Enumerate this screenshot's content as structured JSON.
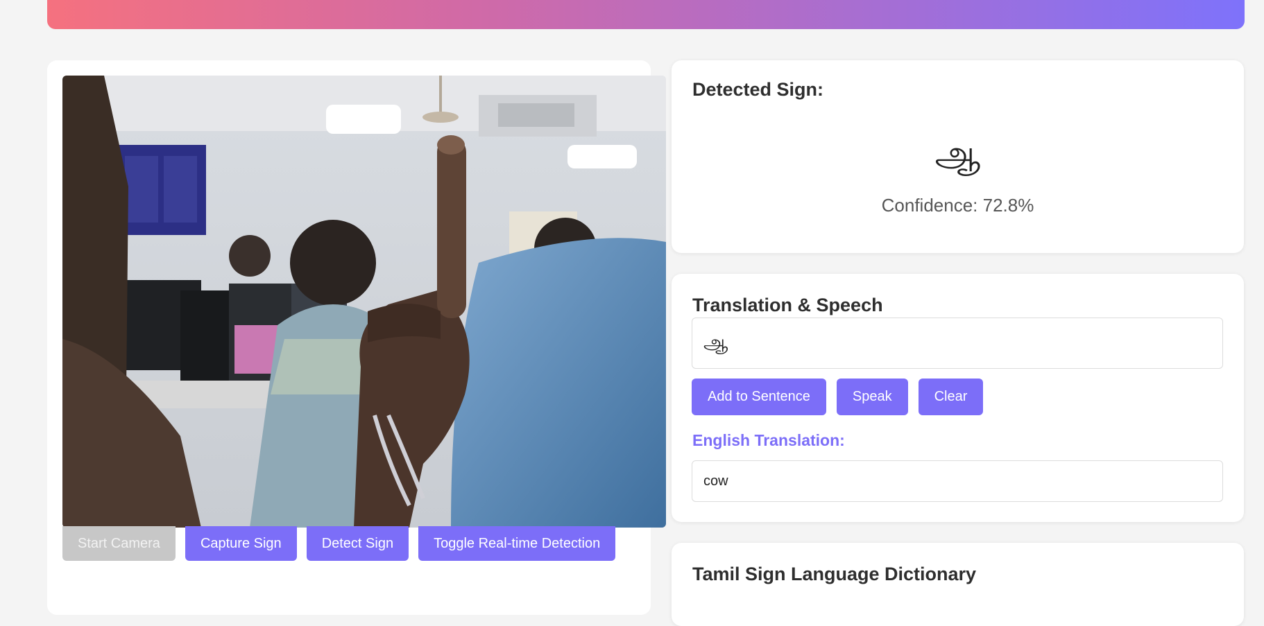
{
  "colors": {
    "accent": "#7c6ef8",
    "banner_start": "#f5717f",
    "banner_end": "#7e72fb",
    "disabled_button": "#c7c7c7"
  },
  "camera": {
    "buttons": {
      "start": "Start Camera",
      "capture": "Capture Sign",
      "detect": "Detect Sign",
      "toggle": "Toggle Real-time Detection"
    }
  },
  "detection": {
    "heading": "Detected Sign:",
    "sign": "ஆ",
    "confidence_text": "Confidence: 72.8%"
  },
  "translation": {
    "heading": "Translation & Speech",
    "tamil_text": "ஆ",
    "buttons": {
      "add": "Add to Sentence",
      "speak": "Speak",
      "clear": "Clear"
    },
    "english_label": "English Translation:",
    "english_text": "cow"
  },
  "dictionary": {
    "heading": "Tamil Sign Language Dictionary"
  }
}
